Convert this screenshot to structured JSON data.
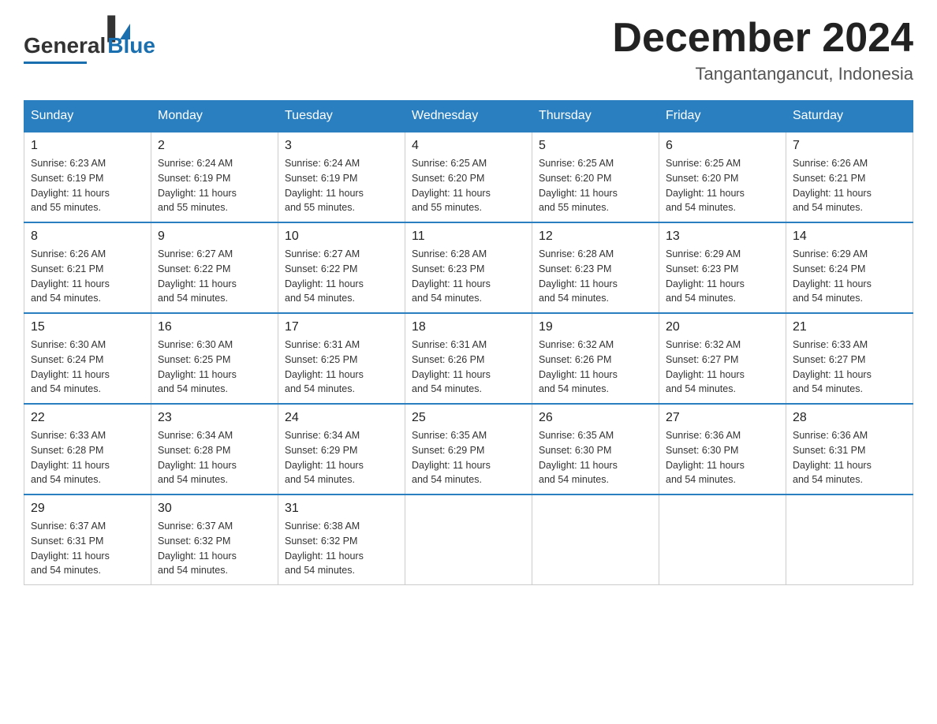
{
  "logo": {
    "general": "General",
    "blue": "Blue"
  },
  "title": {
    "month_year": "December 2024",
    "location": "Tangantangancut, Indonesia"
  },
  "headers": [
    "Sunday",
    "Monday",
    "Tuesday",
    "Wednesday",
    "Thursday",
    "Friday",
    "Saturday"
  ],
  "weeks": [
    [
      {
        "day": "1",
        "sunrise": "6:23 AM",
        "sunset": "6:19 PM",
        "daylight": "11 hours and 55 minutes."
      },
      {
        "day": "2",
        "sunrise": "6:24 AM",
        "sunset": "6:19 PM",
        "daylight": "11 hours and 55 minutes."
      },
      {
        "day": "3",
        "sunrise": "6:24 AM",
        "sunset": "6:19 PM",
        "daylight": "11 hours and 55 minutes."
      },
      {
        "day": "4",
        "sunrise": "6:25 AM",
        "sunset": "6:20 PM",
        "daylight": "11 hours and 55 minutes."
      },
      {
        "day": "5",
        "sunrise": "6:25 AM",
        "sunset": "6:20 PM",
        "daylight": "11 hours and 55 minutes."
      },
      {
        "day": "6",
        "sunrise": "6:25 AM",
        "sunset": "6:20 PM",
        "daylight": "11 hours and 54 minutes."
      },
      {
        "day": "7",
        "sunrise": "6:26 AM",
        "sunset": "6:21 PM",
        "daylight": "11 hours and 54 minutes."
      }
    ],
    [
      {
        "day": "8",
        "sunrise": "6:26 AM",
        "sunset": "6:21 PM",
        "daylight": "11 hours and 54 minutes."
      },
      {
        "day": "9",
        "sunrise": "6:27 AM",
        "sunset": "6:22 PM",
        "daylight": "11 hours and 54 minutes."
      },
      {
        "day": "10",
        "sunrise": "6:27 AM",
        "sunset": "6:22 PM",
        "daylight": "11 hours and 54 minutes."
      },
      {
        "day": "11",
        "sunrise": "6:28 AM",
        "sunset": "6:23 PM",
        "daylight": "11 hours and 54 minutes."
      },
      {
        "day": "12",
        "sunrise": "6:28 AM",
        "sunset": "6:23 PM",
        "daylight": "11 hours and 54 minutes."
      },
      {
        "day": "13",
        "sunrise": "6:29 AM",
        "sunset": "6:23 PM",
        "daylight": "11 hours and 54 minutes."
      },
      {
        "day": "14",
        "sunrise": "6:29 AM",
        "sunset": "6:24 PM",
        "daylight": "11 hours and 54 minutes."
      }
    ],
    [
      {
        "day": "15",
        "sunrise": "6:30 AM",
        "sunset": "6:24 PM",
        "daylight": "11 hours and 54 minutes."
      },
      {
        "day": "16",
        "sunrise": "6:30 AM",
        "sunset": "6:25 PM",
        "daylight": "11 hours and 54 minutes."
      },
      {
        "day": "17",
        "sunrise": "6:31 AM",
        "sunset": "6:25 PM",
        "daylight": "11 hours and 54 minutes."
      },
      {
        "day": "18",
        "sunrise": "6:31 AM",
        "sunset": "6:26 PM",
        "daylight": "11 hours and 54 minutes."
      },
      {
        "day": "19",
        "sunrise": "6:32 AM",
        "sunset": "6:26 PM",
        "daylight": "11 hours and 54 minutes."
      },
      {
        "day": "20",
        "sunrise": "6:32 AM",
        "sunset": "6:27 PM",
        "daylight": "11 hours and 54 minutes."
      },
      {
        "day": "21",
        "sunrise": "6:33 AM",
        "sunset": "6:27 PM",
        "daylight": "11 hours and 54 minutes."
      }
    ],
    [
      {
        "day": "22",
        "sunrise": "6:33 AM",
        "sunset": "6:28 PM",
        "daylight": "11 hours and 54 minutes."
      },
      {
        "day": "23",
        "sunrise": "6:34 AM",
        "sunset": "6:28 PM",
        "daylight": "11 hours and 54 minutes."
      },
      {
        "day": "24",
        "sunrise": "6:34 AM",
        "sunset": "6:29 PM",
        "daylight": "11 hours and 54 minutes."
      },
      {
        "day": "25",
        "sunrise": "6:35 AM",
        "sunset": "6:29 PM",
        "daylight": "11 hours and 54 minutes."
      },
      {
        "day": "26",
        "sunrise": "6:35 AM",
        "sunset": "6:30 PM",
        "daylight": "11 hours and 54 minutes."
      },
      {
        "day": "27",
        "sunrise": "6:36 AM",
        "sunset": "6:30 PM",
        "daylight": "11 hours and 54 minutes."
      },
      {
        "day": "28",
        "sunrise": "6:36 AM",
        "sunset": "6:31 PM",
        "daylight": "11 hours and 54 minutes."
      }
    ],
    [
      {
        "day": "29",
        "sunrise": "6:37 AM",
        "sunset": "6:31 PM",
        "daylight": "11 hours and 54 minutes."
      },
      {
        "day": "30",
        "sunrise": "6:37 AM",
        "sunset": "6:32 PM",
        "daylight": "11 hours and 54 minutes."
      },
      {
        "day": "31",
        "sunrise": "6:38 AM",
        "sunset": "6:32 PM",
        "daylight": "11 hours and 54 minutes."
      },
      null,
      null,
      null,
      null
    ]
  ],
  "labels": {
    "sunrise": "Sunrise:",
    "sunset": "Sunset:",
    "daylight": "Daylight:"
  }
}
